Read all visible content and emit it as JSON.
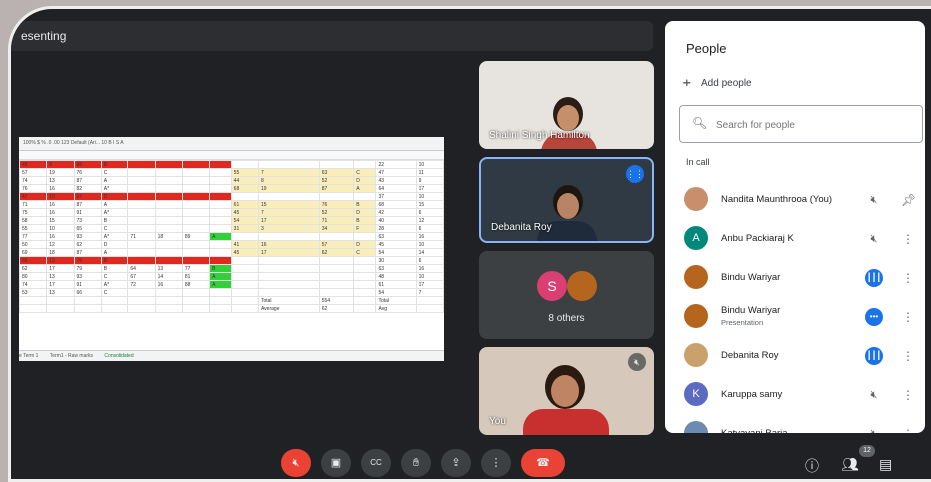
{
  "presenting_bar": {
    "text": "esenting"
  },
  "spreadsheet": {
    "tabs": [
      "e Term 1",
      "Term1 - Raw marks",
      "Consolidated"
    ],
    "toolbar_text": "100%   $  %  .0  .00  123   Default (Ari...   10   B  I  S  A",
    "rows": [
      [
        "45",
        "9",
        "88",
        "B",
        "",
        "",
        "",
        "",
        "",
        "",
        "",
        "",
        "22",
        "10"
      ],
      [
        "57",
        "19",
        "76",
        "C",
        "",
        "",
        "",
        "",
        "55",
        "7",
        "63",
        "C",
        "47",
        "11"
      ],
      [
        "74",
        "13",
        "87",
        "A",
        "",
        "",
        "",
        "",
        "44",
        "8",
        "52",
        "D",
        "43",
        "9"
      ],
      [
        "76",
        "16",
        "82",
        "A*",
        "",
        "",
        "",
        "",
        "68",
        "19",
        "87",
        "A",
        "64",
        "17"
      ],
      [
        "47",
        "10",
        "57",
        "D",
        "",
        "",
        "",
        "",
        "",
        "",
        "",
        "",
        "37",
        "10"
      ],
      [
        "71",
        "16",
        "87",
        "A",
        "",
        "",
        "",
        "",
        "61",
        "15",
        "76",
        "B",
        "68",
        "15"
      ],
      [
        "75",
        "16",
        "91",
        "A*",
        "",
        "",
        "",
        "",
        "45",
        "7",
        "52",
        "D",
        "42",
        "6"
      ],
      [
        "58",
        "15",
        "73",
        "B",
        "",
        "",
        "",
        "",
        "54",
        "17",
        "71",
        "B",
        "40",
        "12"
      ],
      [
        "55",
        "10",
        "65",
        "C",
        "",
        "",
        "",
        "",
        "31",
        "3",
        "34",
        "F",
        "28",
        "6"
      ],
      [
        "77",
        "16",
        "93",
        "A*",
        "71",
        "18",
        "89",
        "A",
        "",
        "",
        "",
        "",
        "63",
        "16"
      ],
      [
        "50",
        "12",
        "62",
        "D",
        "",
        "",
        "",
        "",
        "41",
        "16",
        "57",
        "D",
        "45",
        "10"
      ],
      [
        "69",
        "18",
        "87",
        "A",
        "",
        "",
        "",
        "",
        "45",
        "17",
        "62",
        "C",
        "54",
        "14"
      ],
      [
        "65",
        "13",
        "78",
        "B",
        "",
        "",
        "",
        "",
        "",
        "",
        "",
        "",
        "30",
        "6"
      ],
      [
        "62",
        "17",
        "79",
        "B",
        "64",
        "13",
        "77",
        "B",
        "",
        "",
        "",
        "",
        "63",
        "16"
      ],
      [
        "80",
        "13",
        "93",
        "C",
        "67",
        "14",
        "81",
        "A",
        "",
        "",
        "",
        "",
        "48",
        "10"
      ],
      [
        "74",
        "17",
        "91",
        "A*",
        "72",
        "16",
        "88",
        "A",
        "",
        "",
        "",
        "",
        "61",
        "17"
      ],
      [
        "53",
        "13",
        "66",
        "C",
        "",
        "",
        "",
        "",
        "",
        "",
        "",
        "",
        "54",
        "7"
      ],
      [
        "",
        "",
        "",
        "",
        "",
        "",
        "",
        "",
        "",
        "Total",
        "554",
        "",
        "Total",
        ""
      ],
      [
        "",
        "",
        "",
        "",
        "",
        "",
        "",
        "",
        "",
        "Average",
        "62",
        "",
        "Avg",
        ""
      ]
    ]
  },
  "tiles": {
    "shalini": "Shalini Singh Hamilton",
    "debanita": "Debanita Roy",
    "others_label": "8 others",
    "others_avatar_letter": "S",
    "you": "You"
  },
  "people_panel": {
    "title": "People",
    "add_people": "Add people",
    "search_placeholder": "Search for people",
    "in_call_label": "In call",
    "participants": [
      {
        "name": "Nandita Maunthrooa (You)",
        "sub": "",
        "avatar_letter": "",
        "avatar_color": "#c98f6c",
        "status": "muted",
        "extra": "pin"
      },
      {
        "name": "Anbu Packiaraj K",
        "sub": "",
        "avatar_letter": "A",
        "avatar_color": "#00897b",
        "status": "muted",
        "extra": "more"
      },
      {
        "name": "Bindu Wariyar",
        "sub": "",
        "avatar_letter": "",
        "avatar_color": "#b5651d",
        "status": "speaking",
        "extra": "more"
      },
      {
        "name": "Bindu Wariyar",
        "sub": "Presentation",
        "avatar_letter": "",
        "avatar_color": "#b5651d",
        "status": "active",
        "extra": "more"
      },
      {
        "name": "Debanita Roy",
        "sub": "",
        "avatar_letter": "",
        "avatar_color": "#caa16a",
        "status": "speaking",
        "extra": "more"
      },
      {
        "name": "Karuppa samy",
        "sub": "",
        "avatar_letter": "K",
        "avatar_color": "#5c6bc0",
        "status": "muted",
        "extra": "more"
      },
      {
        "name": "Katyayani Baria",
        "sub": "",
        "avatar_letter": "",
        "avatar_color": "#6d8bb0",
        "status": "muted",
        "extra": "more"
      }
    ]
  },
  "controls": {
    "participant_count": "12"
  }
}
